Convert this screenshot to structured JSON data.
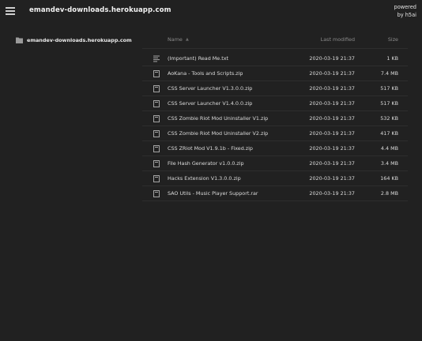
{
  "header": {
    "title": "emandev-downloads.herokuapp.com",
    "powered_line1": "powered",
    "powered_line2": "by h5ai"
  },
  "sidebar": {
    "folder_label": "emandev-downloads.herokuapp.com"
  },
  "listing": {
    "columns": {
      "name": "Name",
      "modified": "Last modified",
      "size": "Size"
    },
    "sort_indicator": "▲",
    "rows": [
      {
        "icon": "text-file-icon",
        "name": "(Important) Read Me.txt",
        "modified": "2020-03-19 21:37",
        "size": "1 KB"
      },
      {
        "icon": "archive-file-icon",
        "name": "AoKana - Tools and Scripts.zip",
        "modified": "2020-03-19 21:37",
        "size": "7.4 MB"
      },
      {
        "icon": "archive-file-icon",
        "name": "CSS Server Launcher V1.3.0.0.zip",
        "modified": "2020-03-19 21:37",
        "size": "517 KB"
      },
      {
        "icon": "archive-file-icon",
        "name": "CSS Server Launcher V1.4.0.0.zip",
        "modified": "2020-03-19 21:37",
        "size": "517 KB"
      },
      {
        "icon": "archive-file-icon",
        "name": "CSS Zombie Riot Mod Uninstaller V1.zip",
        "modified": "2020-03-19 21:37",
        "size": "532 KB"
      },
      {
        "icon": "archive-file-icon",
        "name": "CSS Zombie Riot Mod Uninstaller V2.zip",
        "modified": "2020-03-19 21:37",
        "size": "417 KB"
      },
      {
        "icon": "archive-file-icon",
        "name": "CSS ZRiot Mod V1.9.1b - Fixed.zip",
        "modified": "2020-03-19 21:37",
        "size": "4.4 MB"
      },
      {
        "icon": "archive-file-icon",
        "name": "File Hash Generator v1.0.0.zip",
        "modified": "2020-03-19 21:37",
        "size": "3.4 MB"
      },
      {
        "icon": "archive-file-icon",
        "name": "Hacks Extension V1.3.0.0.zip",
        "modified": "2020-03-19 21:37",
        "size": "164 KB"
      },
      {
        "icon": "archive-file-icon",
        "name": "SAO Utils - Music Player Support.rar",
        "modified": "2020-03-19 21:37",
        "size": "2.8 MB"
      }
    ]
  }
}
